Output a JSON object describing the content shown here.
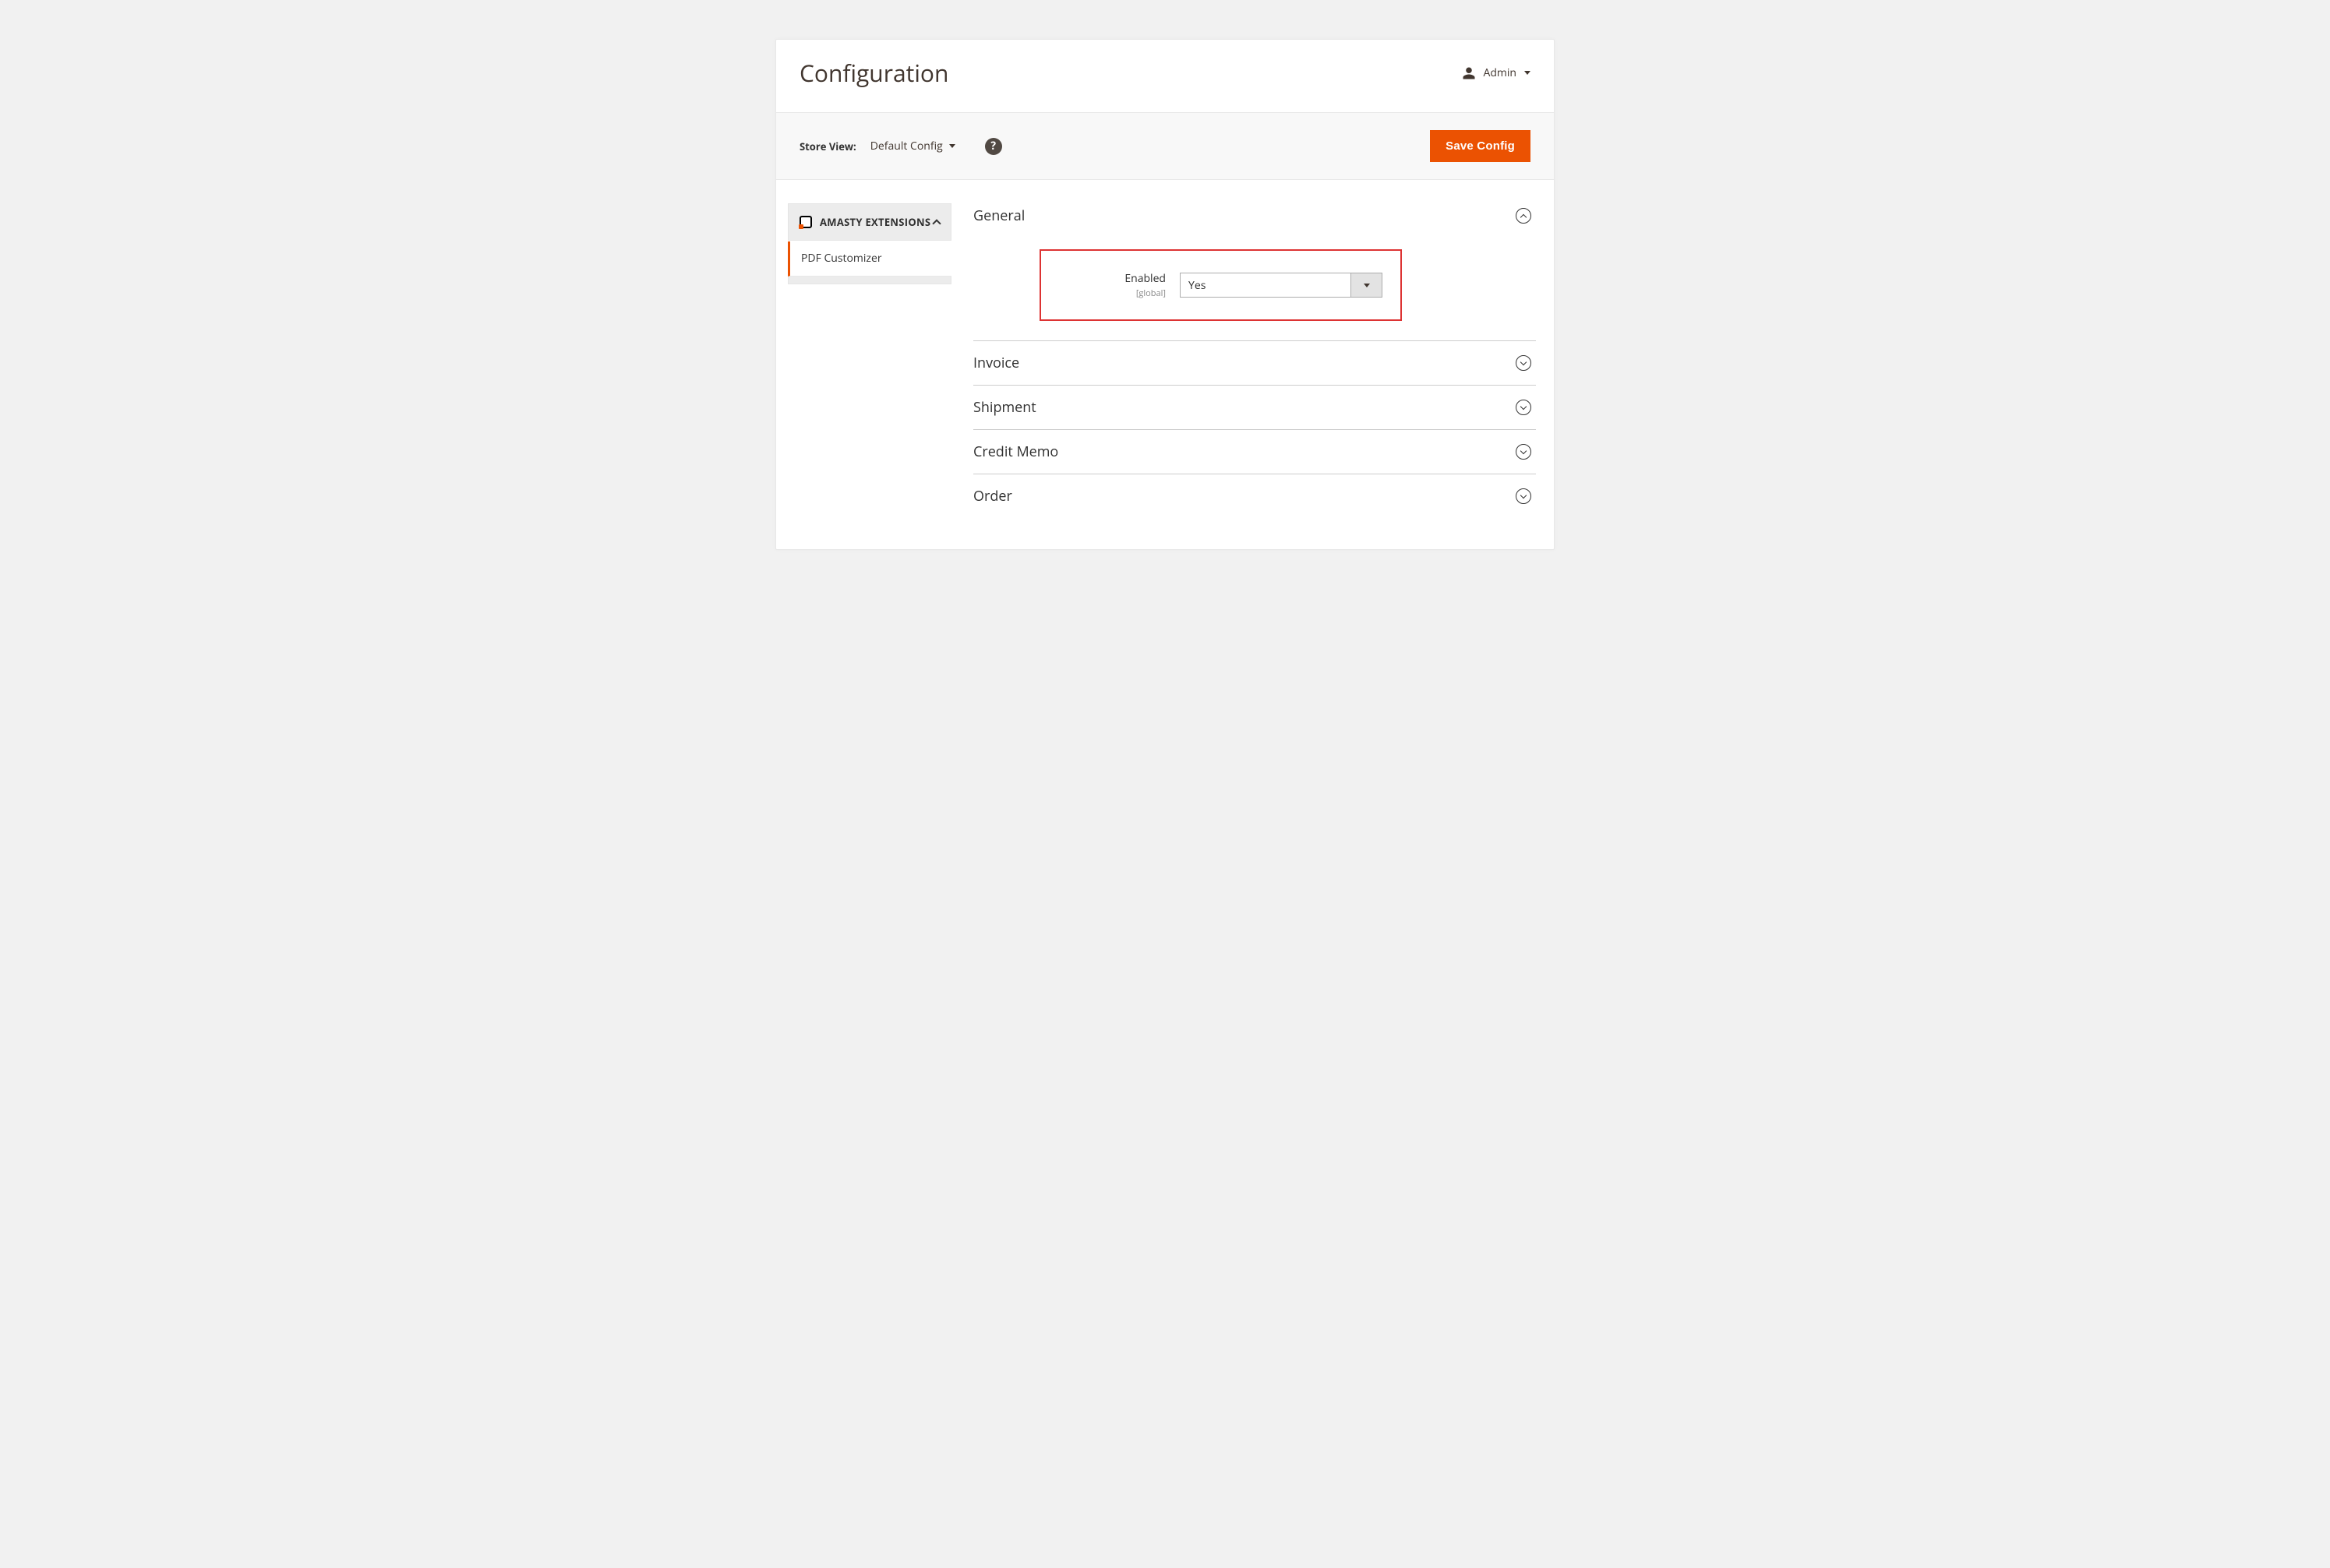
{
  "header": {
    "title": "Configuration",
    "user": "Admin"
  },
  "toolbar": {
    "store_label": "Store View:",
    "store_value": "Default Config",
    "save_label": "Save Config"
  },
  "sidebar": {
    "group_title": "AMASTY EXTENSIONS",
    "items": [
      {
        "label": "PDF Customizer"
      }
    ]
  },
  "sections": {
    "general": {
      "title": "General",
      "expanded": true,
      "enabled_label": "Enabled",
      "enabled_scope": "[global]",
      "enabled_value": "Yes"
    },
    "others": [
      {
        "title": "Invoice"
      },
      {
        "title": "Shipment"
      },
      {
        "title": "Credit Memo"
      },
      {
        "title": "Order"
      }
    ]
  }
}
